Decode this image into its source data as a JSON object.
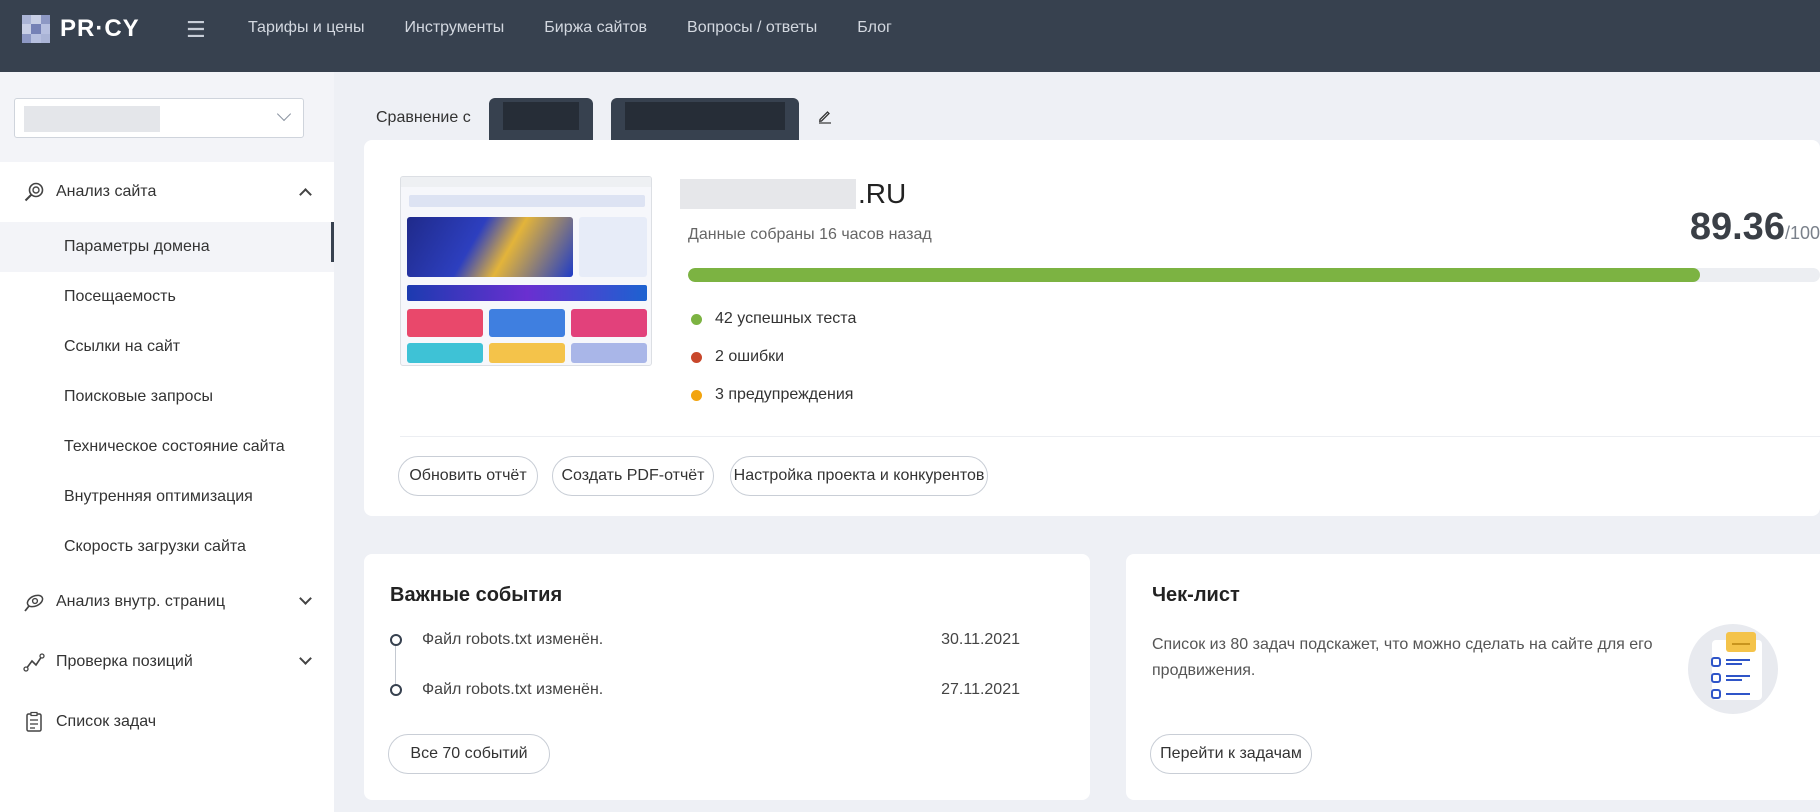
{
  "header": {
    "logo_text": "PR·CY",
    "menu_icon": "☰",
    "nav": [
      "Тарифы и цены",
      "Инструменты",
      "Биржа сайтов",
      "Вопросы / ответы",
      "Блог"
    ]
  },
  "sidebar": {
    "site_select_value": "",
    "groups": [
      {
        "label": "Анализ сайта",
        "icon": "search-analysis-icon",
        "expanded": true,
        "items": [
          "Параметры домена",
          "Посещаемость",
          "Ссылки на сайт",
          "Поисковые запросы",
          "Техническое состояние сайта",
          "Внутренняя оптимизация",
          "Скорость загрузки сайта"
        ]
      },
      {
        "label": "Анализ внутр. страниц",
        "icon": "pages-analysis-icon",
        "expanded": false
      },
      {
        "label": "Проверка позиций",
        "icon": "positions-icon",
        "expanded": false
      },
      {
        "label": "Список задач",
        "icon": "checklist-icon"
      }
    ],
    "active_item": "Параметры домена"
  },
  "compare": {
    "label": "Сравнение с",
    "tabs": [
      "",
      ""
    ]
  },
  "domain_card": {
    "domain_suffix": ".RU",
    "collected": "Данные собраны 16 часов назад",
    "score": "89.36",
    "score_max": "/100",
    "progress_fraction": 0.8936,
    "stats": [
      {
        "text": "42 успешных теста",
        "color": "#7cb342"
      },
      {
        "text": "2 ошибки",
        "color": "#c8472b"
      },
      {
        "text": "3 предупреждения",
        "color": "#f2a40f"
      }
    ],
    "buttons": {
      "refresh": "Обновить отчёт",
      "pdf": "Создать PDF-отчёт",
      "settings": "Настройка проекта и конкурентов"
    }
  },
  "events": {
    "title": "Важные события",
    "items": [
      {
        "text": "Файл robots.txt изменён.",
        "date": "30.11.2021"
      },
      {
        "text": "Файл robots.txt изменён.",
        "date": "27.11.2021"
      }
    ],
    "all_button": "Все 70 событий"
  },
  "checklist": {
    "title": "Чек-лист",
    "text": "Список из 80 задач подскажет, что можно сделать на сайте для его продвижения.",
    "button": "Перейти к задачам"
  },
  "colors": {
    "header_bg": "#37414f",
    "accent_green": "#7cb342"
  }
}
